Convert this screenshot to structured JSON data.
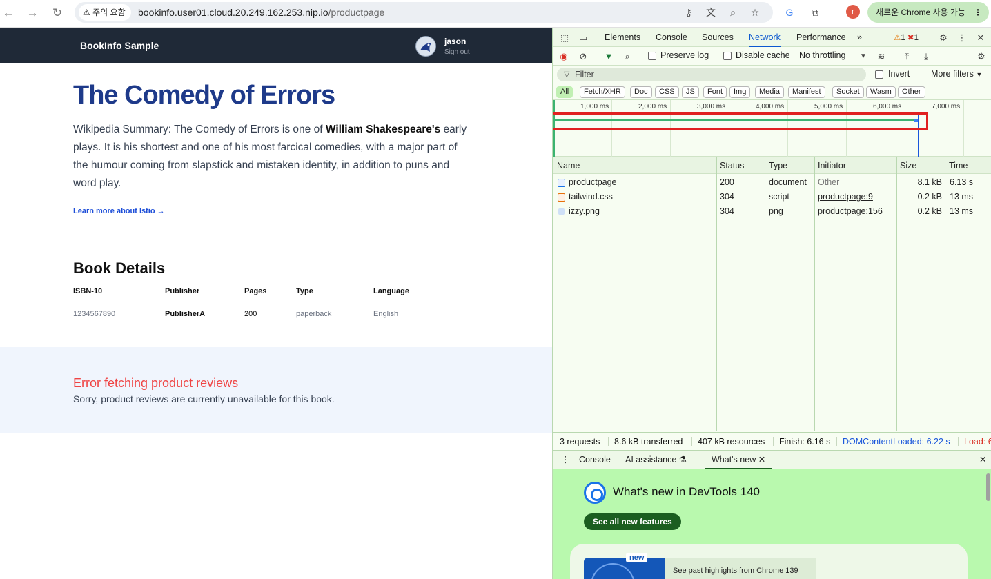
{
  "browser": {
    "security_label": "주의 요함",
    "url_host": "bookinfo.user01.cloud.20.249.162.253.nip.io",
    "url_path": "/productpage",
    "profile_initial": "r",
    "update_label": "새로운 Chrome 사용 가능"
  },
  "app": {
    "brand": "BookInfo Sample",
    "user_name": "jason",
    "sign_out": "Sign out"
  },
  "book": {
    "title": "The Comedy of Errors",
    "summary_before": "Wikipedia Summary: The Comedy of Errors is one of ",
    "summary_bold": "William Shakespeare's",
    "summary_after": " early plays. It is his shortest and one of his most farcical comedies, with a major part of the humour coming from slapstick and mistaken identity, in addition to puns and word play.",
    "learn_more": "Learn more about Istio →"
  },
  "details": {
    "title": "Book Details",
    "headers": [
      "ISBN-10",
      "Publisher",
      "Pages",
      "Type",
      "Language"
    ],
    "values": [
      "1234567890",
      "PublisherA",
      "200",
      "paperback",
      "English"
    ]
  },
  "reviews": {
    "error_title": "Error fetching product reviews",
    "error_text": "Sorry, product reviews are currently unavailable for this book."
  },
  "devtools": {
    "tabs": [
      "Elements",
      "Console",
      "Sources",
      "Network",
      "Performance"
    ],
    "active_tab": "Network",
    "more_tabs": "»",
    "warnings_count": "1",
    "errors_count": "1",
    "toolbar": {
      "preserve_log": "Preserve log",
      "disable_cache": "Disable cache",
      "throttling": "No throttling"
    },
    "filter": {
      "placeholder": "Filter",
      "invert": "Invert",
      "more_filters": "More filters"
    },
    "type_chips": [
      "All",
      "Fetch/XHR",
      "Doc",
      "CSS",
      "JS",
      "Font",
      "Img",
      "Media",
      "Manifest",
      "Socket",
      "Wasm",
      "Other"
    ],
    "timeline_ticks": [
      "1,000 ms",
      "2,000 ms",
      "3,000 ms",
      "4,000 ms",
      "5,000 ms",
      "6,000 ms",
      "7,000 ms"
    ],
    "columns": [
      "Name",
      "Status",
      "Type",
      "Initiator",
      "Size",
      "Time"
    ],
    "requests": [
      {
        "name": "productpage",
        "status": "200",
        "type": "document",
        "initiator": "Other",
        "size": "8.1 kB",
        "time": "6.13 s",
        "icon": "document-icon"
      },
      {
        "name": "tailwind.css",
        "status": "304",
        "type": "script",
        "initiator": "productpage:9",
        "size": "0.2 kB",
        "time": "13 ms",
        "icon": "script-icon"
      },
      {
        "name": "izzy.png",
        "status": "304",
        "type": "png",
        "initiator": "productpage:156",
        "size": "0.2 kB",
        "time": "13 ms",
        "icon": "image-icon"
      }
    ],
    "status_bar": {
      "requests": "3 requests",
      "transferred": "8.6 kB transferred",
      "resources": "407 kB resources",
      "finish": "Finish: 6.16 s",
      "dom_content_loaded": "DOMContentLoaded: 6.22 s",
      "load": "Load: 6"
    },
    "drawer": {
      "tabs": [
        "Console",
        "AI assistance",
        "What's new"
      ],
      "active_tab": "What's new",
      "title": "What's new in DevTools 140",
      "see_all": "See all new features",
      "new_badge": "new",
      "past_highlights": "See past highlights from Chrome 139"
    }
  },
  "colors": {
    "brand_title": "#1e3a8a",
    "topbar": "#1f2937",
    "error": "#ef4444",
    "link": "#1d4ed8",
    "devtools_bg": "#f7fdf2",
    "highlight_box": "#e02020"
  }
}
